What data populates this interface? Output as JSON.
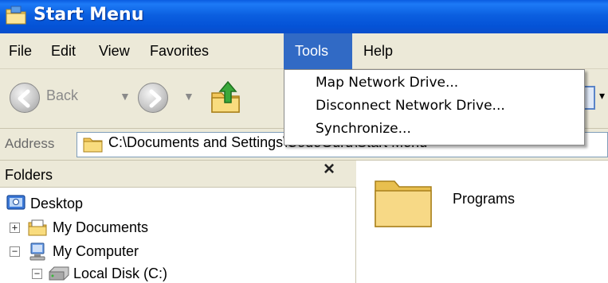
{
  "window": {
    "title": "Start Menu"
  },
  "menubar": {
    "items": [
      {
        "label": "File"
      },
      {
        "label": "Edit"
      },
      {
        "label": "View"
      },
      {
        "label": "Favorites"
      },
      {
        "label": "Tools"
      },
      {
        "label": "Help"
      }
    ],
    "active": "Tools"
  },
  "tools_menu": {
    "items": [
      {
        "label": "Map Network Drive..."
      },
      {
        "label": "Disconnect Network Drive..."
      },
      {
        "label": "Synchronize..."
      }
    ]
  },
  "toolbar": {
    "back_label": "Back"
  },
  "address": {
    "label": "Address",
    "value": "C:\\Documents and Settings\\CodeGuru\\Start Menu"
  },
  "folders_pane": {
    "title": "Folders",
    "close_glyph": "×",
    "tree": [
      {
        "label": "Desktop",
        "icon": "desktop-icon"
      },
      {
        "label": "My Documents",
        "icon": "my-documents-icon",
        "expander": "+"
      },
      {
        "label": "My Computer",
        "icon": "my-computer-icon",
        "expander": "−"
      },
      {
        "label": "Local Disk (C:)",
        "icon": "local-disk-icon",
        "expander": "−"
      }
    ]
  },
  "content": {
    "items": [
      {
        "label": "Programs",
        "icon": "folder-icon"
      }
    ]
  },
  "colors": {
    "titlebar": "#0b5fe0",
    "menu_highlight": "#316ac5",
    "chrome": "#ece9d8"
  }
}
